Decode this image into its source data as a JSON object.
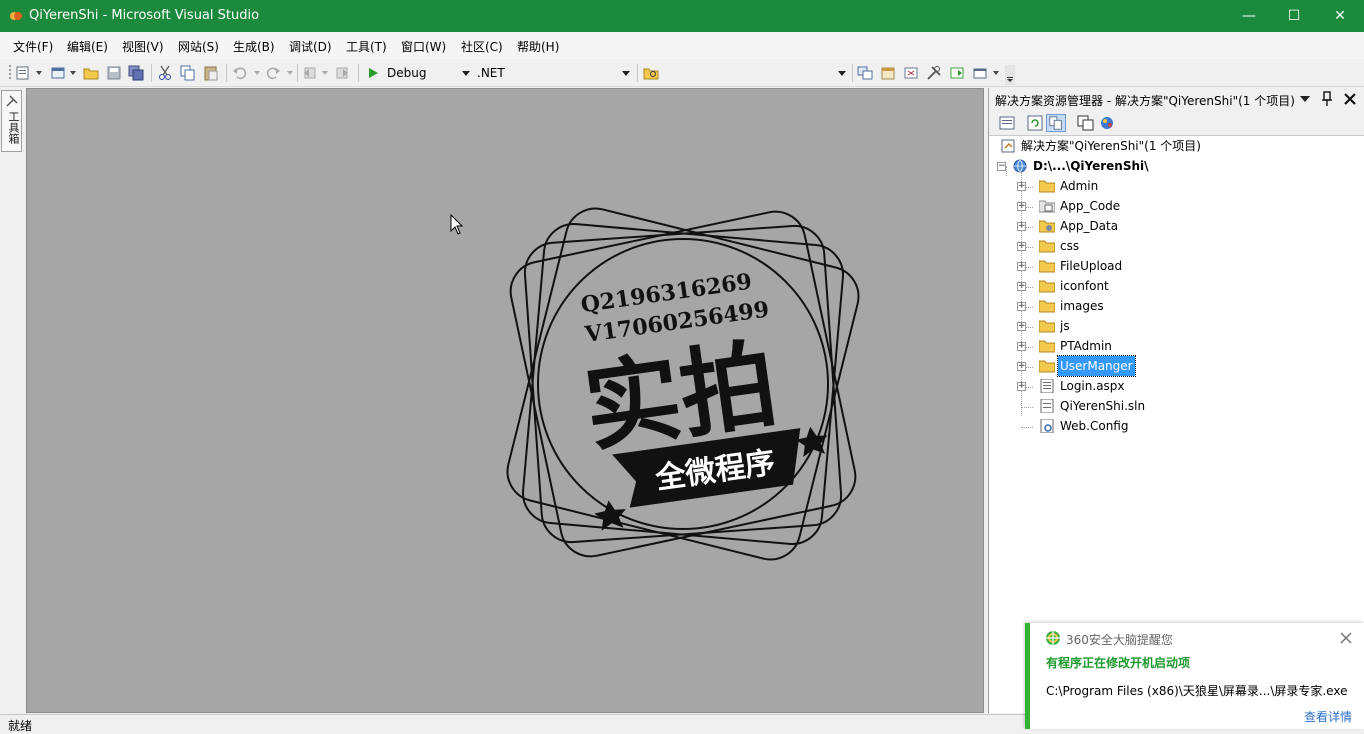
{
  "window": {
    "title": "QiYerenShi - Microsoft Visual Studio",
    "minimize_glyph": "—",
    "maximize_glyph": "☐",
    "close_glyph": "✕"
  },
  "menu": {
    "items": [
      {
        "label": "文件(F)"
      },
      {
        "label": "编辑(E)"
      },
      {
        "label": "视图(V)"
      },
      {
        "label": "网站(S)"
      },
      {
        "label": "生成(B)"
      },
      {
        "label": "调试(D)"
      },
      {
        "label": "工具(T)"
      },
      {
        "label": "窗口(W)"
      },
      {
        "label": "社区(C)"
      },
      {
        "label": "帮助(H)"
      }
    ]
  },
  "toolbar": {
    "config_value": "Debug",
    "platform_value": ".NET"
  },
  "toolbox": {
    "label": "工具箱"
  },
  "watermark": {
    "line1": "Q2196316269",
    "line2": "V17060256499",
    "main_text": "实拍",
    "banner_text": "全微程序"
  },
  "solution_explorer": {
    "title": "解决方案资源管理器 - 解决方案\"QiYerenShi\"(1 个项目)",
    "solution_node": "解决方案\"QiYerenShi\"(1 个项目)",
    "project_node": "D:\\...\\QiYerenShi\\",
    "items": [
      {
        "label": "Admin",
        "icon": "folder-icon"
      },
      {
        "label": "App_Code",
        "icon": "special-folder-icon"
      },
      {
        "label": "App_Data",
        "icon": "data-folder-icon"
      },
      {
        "label": "css",
        "icon": "folder-icon"
      },
      {
        "label": "FileUpload",
        "icon": "folder-icon"
      },
      {
        "label": "iconfont",
        "icon": "folder-icon"
      },
      {
        "label": "images",
        "icon": "folder-icon"
      },
      {
        "label": "js",
        "icon": "folder-icon"
      },
      {
        "label": "PTAdmin",
        "icon": "folder-icon"
      },
      {
        "label": "UserManger",
        "icon": "folder-icon",
        "selected": true
      },
      {
        "label": "Login.aspx",
        "icon": "aspx-file-icon"
      },
      {
        "label": "QiYerenShi.sln",
        "icon": "sln-file-icon"
      },
      {
        "label": "Web.Config",
        "icon": "config-file-icon"
      }
    ]
  },
  "statusbar": {
    "text": "就绪"
  },
  "notification": {
    "source": "360安全大脑提醒您",
    "title": "有程序正在修改开机启动项",
    "path": "C:\\Program Files (x86)\\天狼星\\屏幕录...\\屏录专家.exe",
    "link": "查看详情"
  },
  "colors": {
    "titlebar": "#1c8a3c",
    "editor_bg": "#a6a6a6",
    "selection": "#3399ff",
    "notify_accent": "#34b233"
  }
}
